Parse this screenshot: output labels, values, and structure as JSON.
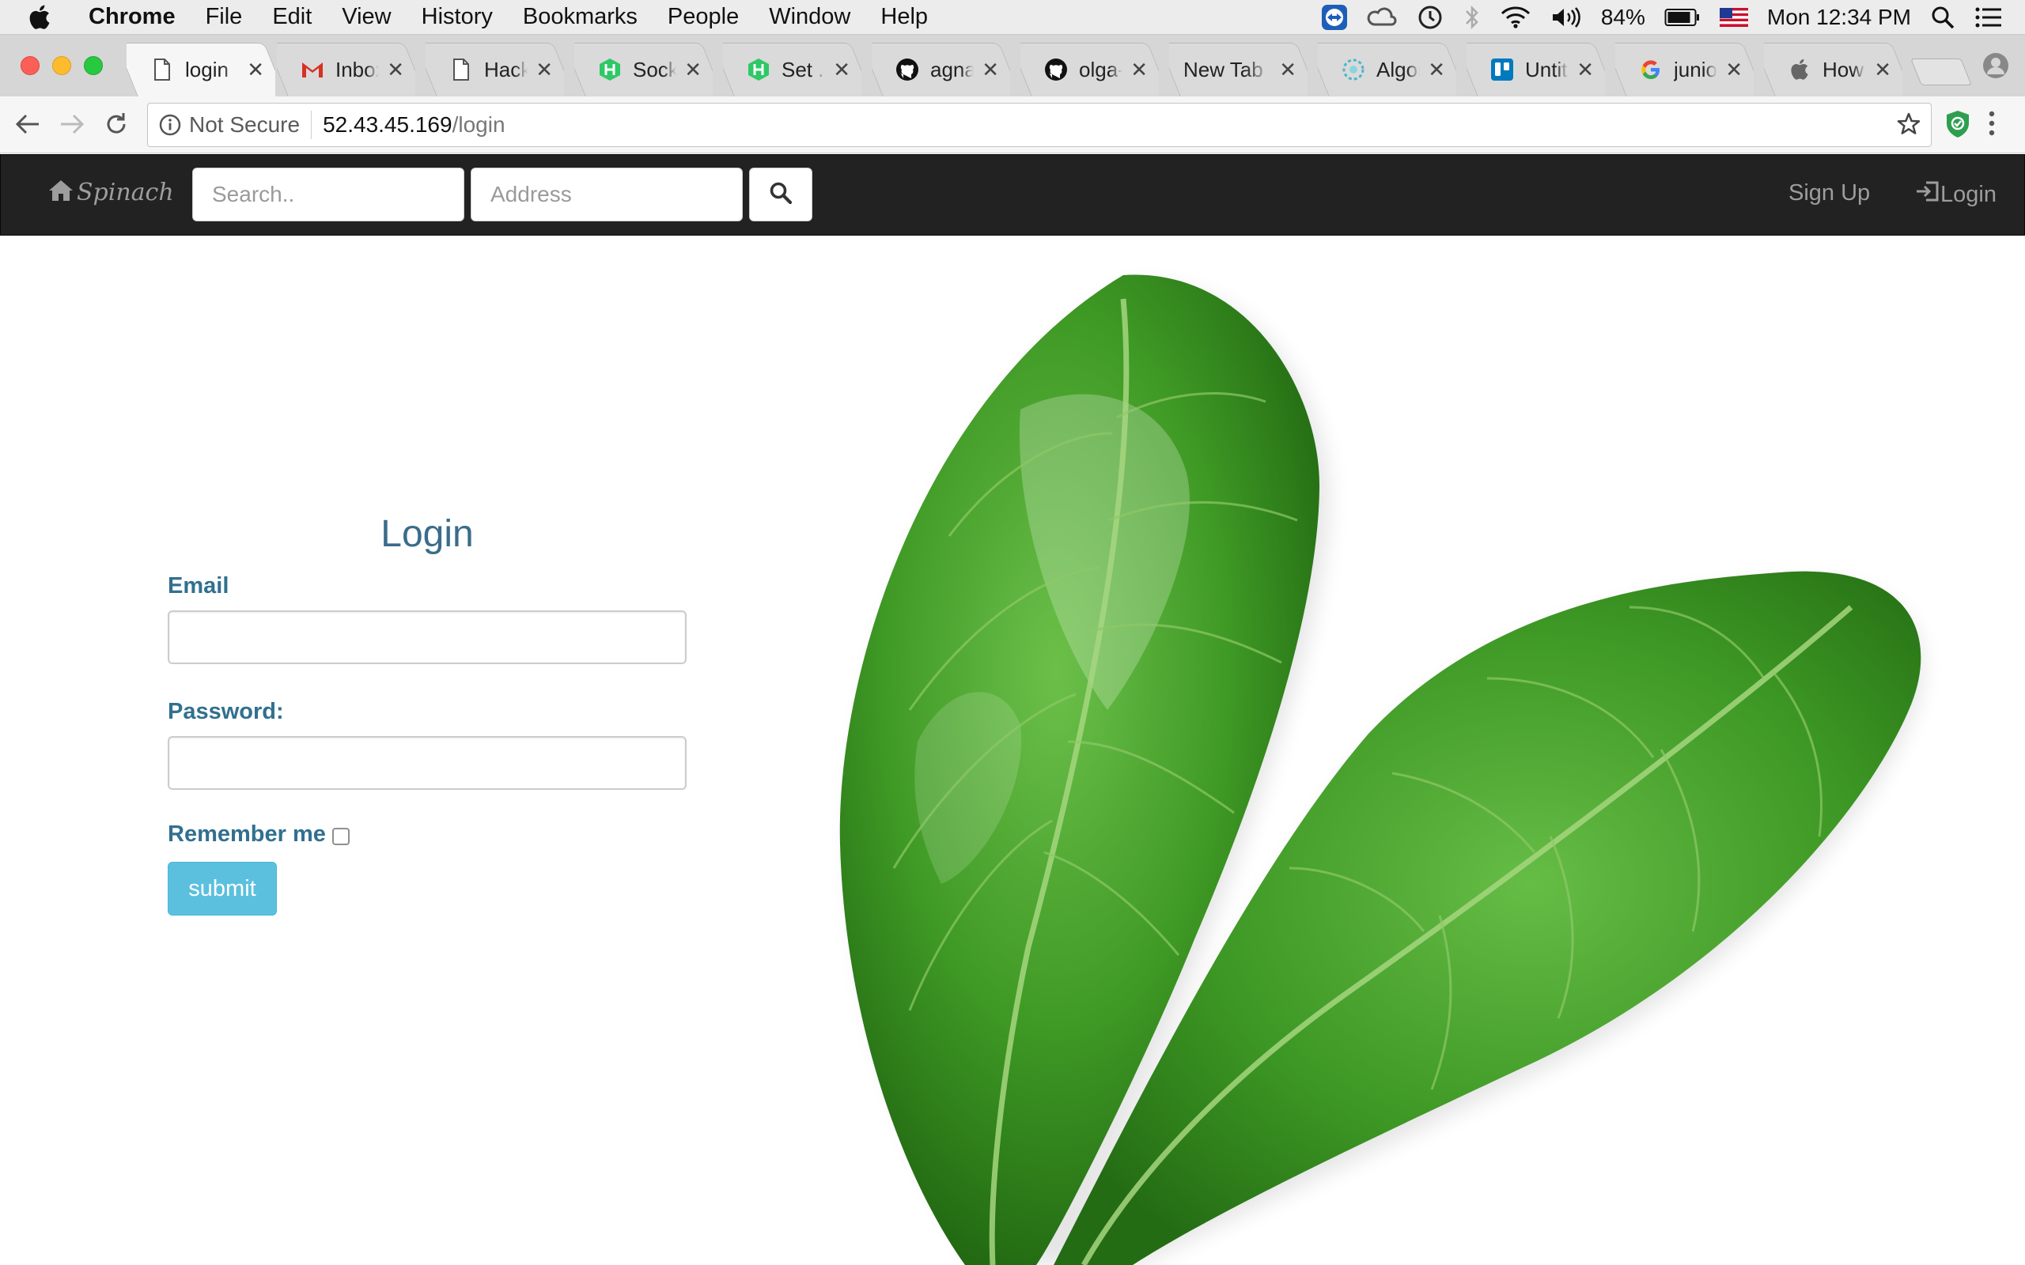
{
  "menubar": {
    "app_name": "Chrome",
    "items": [
      "File",
      "Edit",
      "View",
      "History",
      "Bookmarks",
      "People",
      "Window",
      "Help"
    ],
    "battery_percent": "84%",
    "clock": "Mon 12:34 PM"
  },
  "tabs": [
    {
      "title": "login",
      "favicon": "page-icon",
      "active": true
    },
    {
      "title": "Inbox (",
      "favicon": "gmail-icon"
    },
    {
      "title": "Hacker",
      "favicon": "page-icon"
    },
    {
      "title": "Sock M",
      "favicon": "hackerrank-icon"
    },
    {
      "title": "Set .dis",
      "favicon": "hackerrank-icon"
    },
    {
      "title": "agnaite",
      "favicon": "github-icon"
    },
    {
      "title": "olga-cc",
      "favicon": "github-icon"
    },
    {
      "title": "New Tab",
      "favicon": ""
    },
    {
      "title": "Algorit",
      "favicon": "algorithm-icon"
    },
    {
      "title": "Untitle",
      "favicon": "trello-icon"
    },
    {
      "title": "junior w",
      "favicon": "google-icon"
    },
    {
      "title": "How to",
      "favicon": "apple-icon"
    }
  ],
  "address_bar": {
    "security_label": "Not Secure",
    "host": "52.43.45.169",
    "path": "/login"
  },
  "site_nav": {
    "brand": "Spinach",
    "search_placeholder": "Search..",
    "address_placeholder": "Address",
    "signup_label": "Sign Up",
    "login_label": "Login"
  },
  "login_form": {
    "title": "Login",
    "email_label": "Email",
    "password_label": "Password:",
    "remember_label": "Remember me",
    "remember_checked": false,
    "submit_label": "submit"
  },
  "colors": {
    "navbar_bg": "#222222",
    "label_blue": "#31708f",
    "submit_bg": "#5bc0de"
  }
}
